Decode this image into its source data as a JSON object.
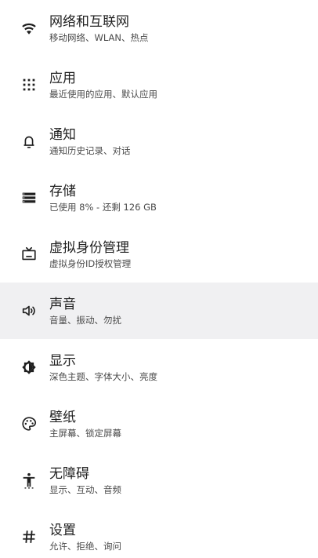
{
  "items": [
    {
      "id": "network",
      "icon": "wifi-icon",
      "title": "网络和互联网",
      "subtitle": "移动网络、WLAN、热点"
    },
    {
      "id": "apps",
      "icon": "apps-grid-icon",
      "title": "应用",
      "subtitle": "最近使用的应用、默认应用"
    },
    {
      "id": "notifications",
      "icon": "bell-icon",
      "title": "通知",
      "subtitle": "通知历史记录、对话"
    },
    {
      "id": "storage",
      "icon": "storage-icon",
      "title": "存储",
      "subtitle": "已使用 8% - 还剩 126 GB"
    },
    {
      "id": "virtual-identity",
      "icon": "tv-icon",
      "title": "虚拟身份管理",
      "subtitle": "虚拟身份ID授权管理"
    },
    {
      "id": "sound",
      "icon": "volume-icon",
      "title": "声音",
      "subtitle": "音量、振动、勿扰"
    },
    {
      "id": "display",
      "icon": "brightness-icon",
      "title": "显示",
      "subtitle": "深色主题、字体大小、亮度"
    },
    {
      "id": "wallpaper",
      "icon": "palette-icon",
      "title": "壁纸",
      "subtitle": "主屏幕、锁定屏幕"
    },
    {
      "id": "accessibility",
      "icon": "accessibility-icon",
      "title": "无障碍",
      "subtitle": "显示、互动、音频"
    },
    {
      "id": "settings",
      "icon": "hash-icon",
      "title": "设置",
      "subtitle": "允许、拒绝、询问"
    }
  ],
  "selected_item": "sound"
}
